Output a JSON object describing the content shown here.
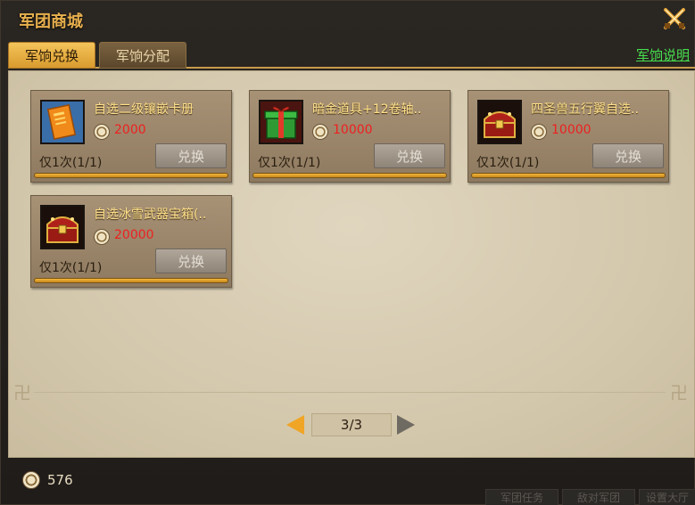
{
  "window": {
    "title": "军团商城"
  },
  "tabs": [
    {
      "label": "军饷兑换",
      "active": true
    },
    {
      "label": "军饷分配",
      "active": false
    }
  ],
  "help_link": "军饷说明",
  "items": [
    {
      "name": "自选二级镶嵌卡册",
      "price": "2000",
      "limit": "仅1次(1/1)",
      "button": "兑换",
      "icon": "orange-card-album-icon"
    },
    {
      "name": "暗金道具+12卷轴..",
      "price": "10000",
      "limit": "仅1次(1/1)",
      "button": "兑换",
      "icon": "green-gift-box-icon"
    },
    {
      "name": "四圣兽五行翼自选..",
      "price": "10000",
      "limit": "仅1次(1/1)",
      "button": "兑换",
      "icon": "red-treasure-chest-icon"
    },
    {
      "name": "自选冰雪武器宝箱(..",
      "price": "20000",
      "limit": "仅1次(1/1)",
      "button": "兑换",
      "icon": "red-treasure-chest-icon"
    }
  ],
  "pagination": {
    "label": "3/3"
  },
  "footer": {
    "currency_amount": "576"
  },
  "background_buttons": [
    "军团任务",
    "敌对军团",
    "设置大厅"
  ],
  "colors": {
    "accent": "#e8b04e",
    "price": "#ee2020",
    "help_link": "#46e04e"
  }
}
